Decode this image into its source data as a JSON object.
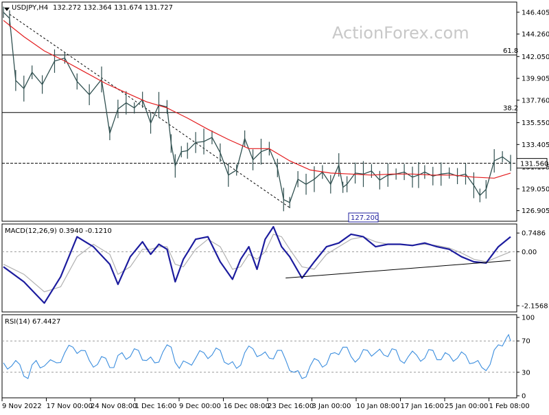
{
  "header": {
    "symbol_label": "USDJPY,H4",
    "ohlc": "132.272 132.364 131.674 131.727",
    "watermark": "ActionForex.com"
  },
  "price_panel": {
    "last_price_tag": "131.560",
    "last_price": 131.56,
    "fib_levels": [
      {
        "label": "61.8",
        "value": 142.2
      },
      {
        "label": "38.2",
        "value": 136.55
      }
    ],
    "low_tag": "127.200"
  },
  "macd_panel": {
    "title": "MACD(12,26,9) 0.3940 -0.1210"
  },
  "rsi_panel": {
    "title": "RSI(14) 67.4427"
  },
  "colors": {
    "price_candles": "#2f4f4f",
    "moving_average": "#e31a1c",
    "macd_line": "#1c1c9e",
    "macd_signal": "#b0b0b0",
    "rsi_line": "#3a8dde",
    "grid": "#000000",
    "low_tag": "#1c1c9e"
  },
  "chart_data": [
    {
      "type": "line",
      "title": "USDJPY,H4",
      "series": [
        {
          "name": "",
          "x": [
            0,
            3,
            6,
            10,
            14,
            19,
            25,
            30,
            36,
            42,
            48,
            52,
            56,
            60,
            64,
            68,
            72,
            76,
            80,
            82,
            84,
            87,
            90,
            94,
            98,
            102,
            106,
            110,
            114,
            118,
            122,
            126,
            130,
            134,
            137,
            140,
            144,
            148,
            152,
            156,
            160,
            164,
            166,
            168,
            172,
            176,
            180,
            184,
            188,
            192,
            196,
            200,
            203,
            206,
            210,
            214,
            218,
            222,
            226,
            230,
            233,
            236,
            240,
            244,
            248
          ],
          "values": [
            146.4,
            145.8,
            139.7,
            138.9,
            140.5,
            139.3,
            141.6,
            141.9,
            139.6,
            138.3,
            139.8,
            134.5,
            136.9,
            137.5,
            137.0,
            137.8,
            135.5,
            137.3,
            137.1,
            133.5,
            131.3,
            132.7,
            132.8,
            133.6,
            133.7,
            134.1,
            132.6,
            130.4,
            130.9,
            134.0,
            131.9,
            132.7,
            133.0,
            131.1,
            128.0,
            127.7,
            130.0,
            129.5,
            130.0,
            130.7,
            129.5,
            131.4,
            129.2,
            129.5,
            130.6,
            130.5,
            130.8,
            129.9,
            130.4,
            130.5,
            130.7,
            130.2,
            130.4,
            130.7,
            130.3,
            130.5,
            130.6,
            130.3,
            130.5,
            129.4,
            128.4,
            129.0,
            131.8,
            132.2,
            131.6
          ]
        },
        {
          "name": "",
          "x": [
            0,
            10,
            20,
            30,
            40,
            50,
            60,
            70,
            80,
            90,
            100,
            110,
            120,
            130,
            140,
            150,
            160,
            170,
            180,
            190,
            200,
            210,
            220,
            230,
            240,
            248
          ],
          "values": [
            145.6,
            144.0,
            142.6,
            141.6,
            140.5,
            139.4,
            138.5,
            137.6,
            137.0,
            136.0,
            134.9,
            133.9,
            133.0,
            133.0,
            131.8,
            130.9,
            130.6,
            130.5,
            130.4,
            130.5,
            130.5,
            130.4,
            130.4,
            130.2,
            130.1,
            130.6
          ]
        }
      ],
      "x_tick_labels": [
        "9 Nov 2022",
        "17 Nov 00:00",
        "24 Nov 08:00",
        "1 Dec 16:00",
        "9 Dec 00:00",
        "16 Dec 08:00",
        "23 Dec 16:00",
        "3 Jan 00:00",
        "10 Jan 08:00",
        "17 Jan 16:00",
        "25 Jan 00:00",
        "1 Feb 08:00"
      ],
      "y_ticks": [
        146.405,
        144.26,
        142.05,
        139.905,
        137.76,
        135.55,
        133.405,
        131.195,
        129.05,
        126.905
      ],
      "y_tick_labels": [
        "146.405",
        "144.260",
        "142.050",
        "139.905",
        "137.760",
        "135.550",
        "133.405",
        "131.195",
        "129.050",
        "126.905"
      ],
      "ylim": [
        126.0,
        147.2
      ],
      "xlim": [
        0,
        250
      ]
    },
    {
      "type": "line",
      "title": "MACD(12,26,9) 0.3940 -0.1210",
      "series": [
        {
          "name": "MACD",
          "x": [
            0,
            10,
            20,
            28,
            36,
            44,
            52,
            56,
            62,
            68,
            72,
            76,
            80,
            84,
            88,
            94,
            100,
            106,
            112,
            116,
            120,
            124,
            128,
            132,
            136,
            140,
            146,
            152,
            158,
            164,
            170,
            176,
            182,
            188,
            194,
            200,
            206,
            212,
            218,
            224,
            230,
            236,
            242,
            248
          ],
          "values": [
            -0.6,
            -1.2,
            -2.05,
            -1.0,
            0.6,
            0.2,
            -0.5,
            -1.3,
            -0.2,
            0.4,
            -0.1,
            0.3,
            0.1,
            -1.2,
            -0.3,
            0.5,
            0.6,
            -0.4,
            -1.1,
            -0.3,
            0.2,
            -0.7,
            0.5,
            1.0,
            0.2,
            -0.2,
            -1.05,
            -0.4,
            0.2,
            0.35,
            0.7,
            0.6,
            0.2,
            0.3,
            0.3,
            0.25,
            0.35,
            0.2,
            0.1,
            -0.2,
            -0.4,
            -0.45,
            0.2,
            0.6
          ]
        },
        {
          "name": "Signal",
          "x": [
            0,
            10,
            20,
            28,
            36,
            44,
            52,
            56,
            62,
            68,
            72,
            76,
            80,
            84,
            88,
            94,
            100,
            106,
            112,
            116,
            120,
            124,
            128,
            132,
            136,
            140,
            146,
            152,
            158,
            164,
            170,
            176,
            182,
            188,
            194,
            200,
            206,
            212,
            218,
            224,
            230,
            236,
            242,
            248
          ],
          "values": [
            -0.5,
            -0.9,
            -1.6,
            -1.4,
            -0.2,
            0.3,
            -0.1,
            -0.9,
            -0.6,
            0.1,
            0.1,
            0.2,
            0.2,
            -0.5,
            -0.6,
            0.1,
            0.5,
            0.2,
            -0.7,
            -0.6,
            -0.1,
            -0.3,
            0.0,
            0.7,
            0.6,
            0.1,
            -0.6,
            -0.7,
            -0.1,
            0.2,
            0.5,
            0.6,
            0.4,
            0.3,
            0.3,
            0.27,
            0.3,
            0.25,
            0.15,
            -0.05,
            -0.3,
            -0.4,
            -0.2,
            0.0
          ]
        }
      ],
      "trendline": {
        "x": [
          138,
          248
        ],
        "values": [
          -1.05,
          -0.35
        ]
      },
      "y_ticks": [
        0.7486,
        0.0,
        -2.1568
      ],
      "y_tick_labels": [
        "0.7486",
        "0.00",
        "-2.1568"
      ],
      "ylim": [
        -2.35,
        1.0
      ]
    },
    {
      "type": "line",
      "title": "RSI(14) 67.4427",
      "series": [
        {
          "name": "RSI(14)",
          "x": [
            0,
            4,
            8,
            12,
            16,
            20,
            26,
            30,
            34,
            38,
            42,
            46,
            50,
            54,
            58,
            62,
            66,
            70,
            74,
            78,
            82,
            86,
            90,
            94,
            98,
            102,
            106,
            110,
            114,
            118,
            122,
            126,
            130,
            134,
            138,
            142,
            146,
            150,
            154,
            158,
            162,
            166,
            170,
            174,
            178,
            182,
            186,
            190,
            194,
            198,
            202,
            206,
            210,
            214,
            218,
            222,
            226,
            230,
            234,
            238,
            242,
            246,
            248
          ],
          "values": [
            42,
            38,
            40,
            22,
            45,
            38,
            42,
            55,
            62,
            58,
            45,
            40,
            48,
            36,
            55,
            50,
            58,
            45,
            42,
            56,
            62,
            35,
            42,
            48,
            55,
            52,
            58,
            40,
            35,
            55,
            60,
            52,
            48,
            58,
            46,
            30,
            22,
            38,
            45,
            40,
            55,
            62,
            50,
            48,
            58,
            55,
            52,
            60,
            45,
            50,
            52,
            48,
            58,
            46,
            52,
            48,
            52,
            42,
            36,
            40,
            65,
            74,
            70
          ]
        }
      ],
      "reference_lines": [
        70,
        30
      ],
      "y_ticks": [
        100,
        70,
        30,
        0
      ],
      "y_tick_labels": [
        "100",
        "70",
        "30",
        "0"
      ],
      "ylim": [
        0,
        100
      ]
    }
  ]
}
